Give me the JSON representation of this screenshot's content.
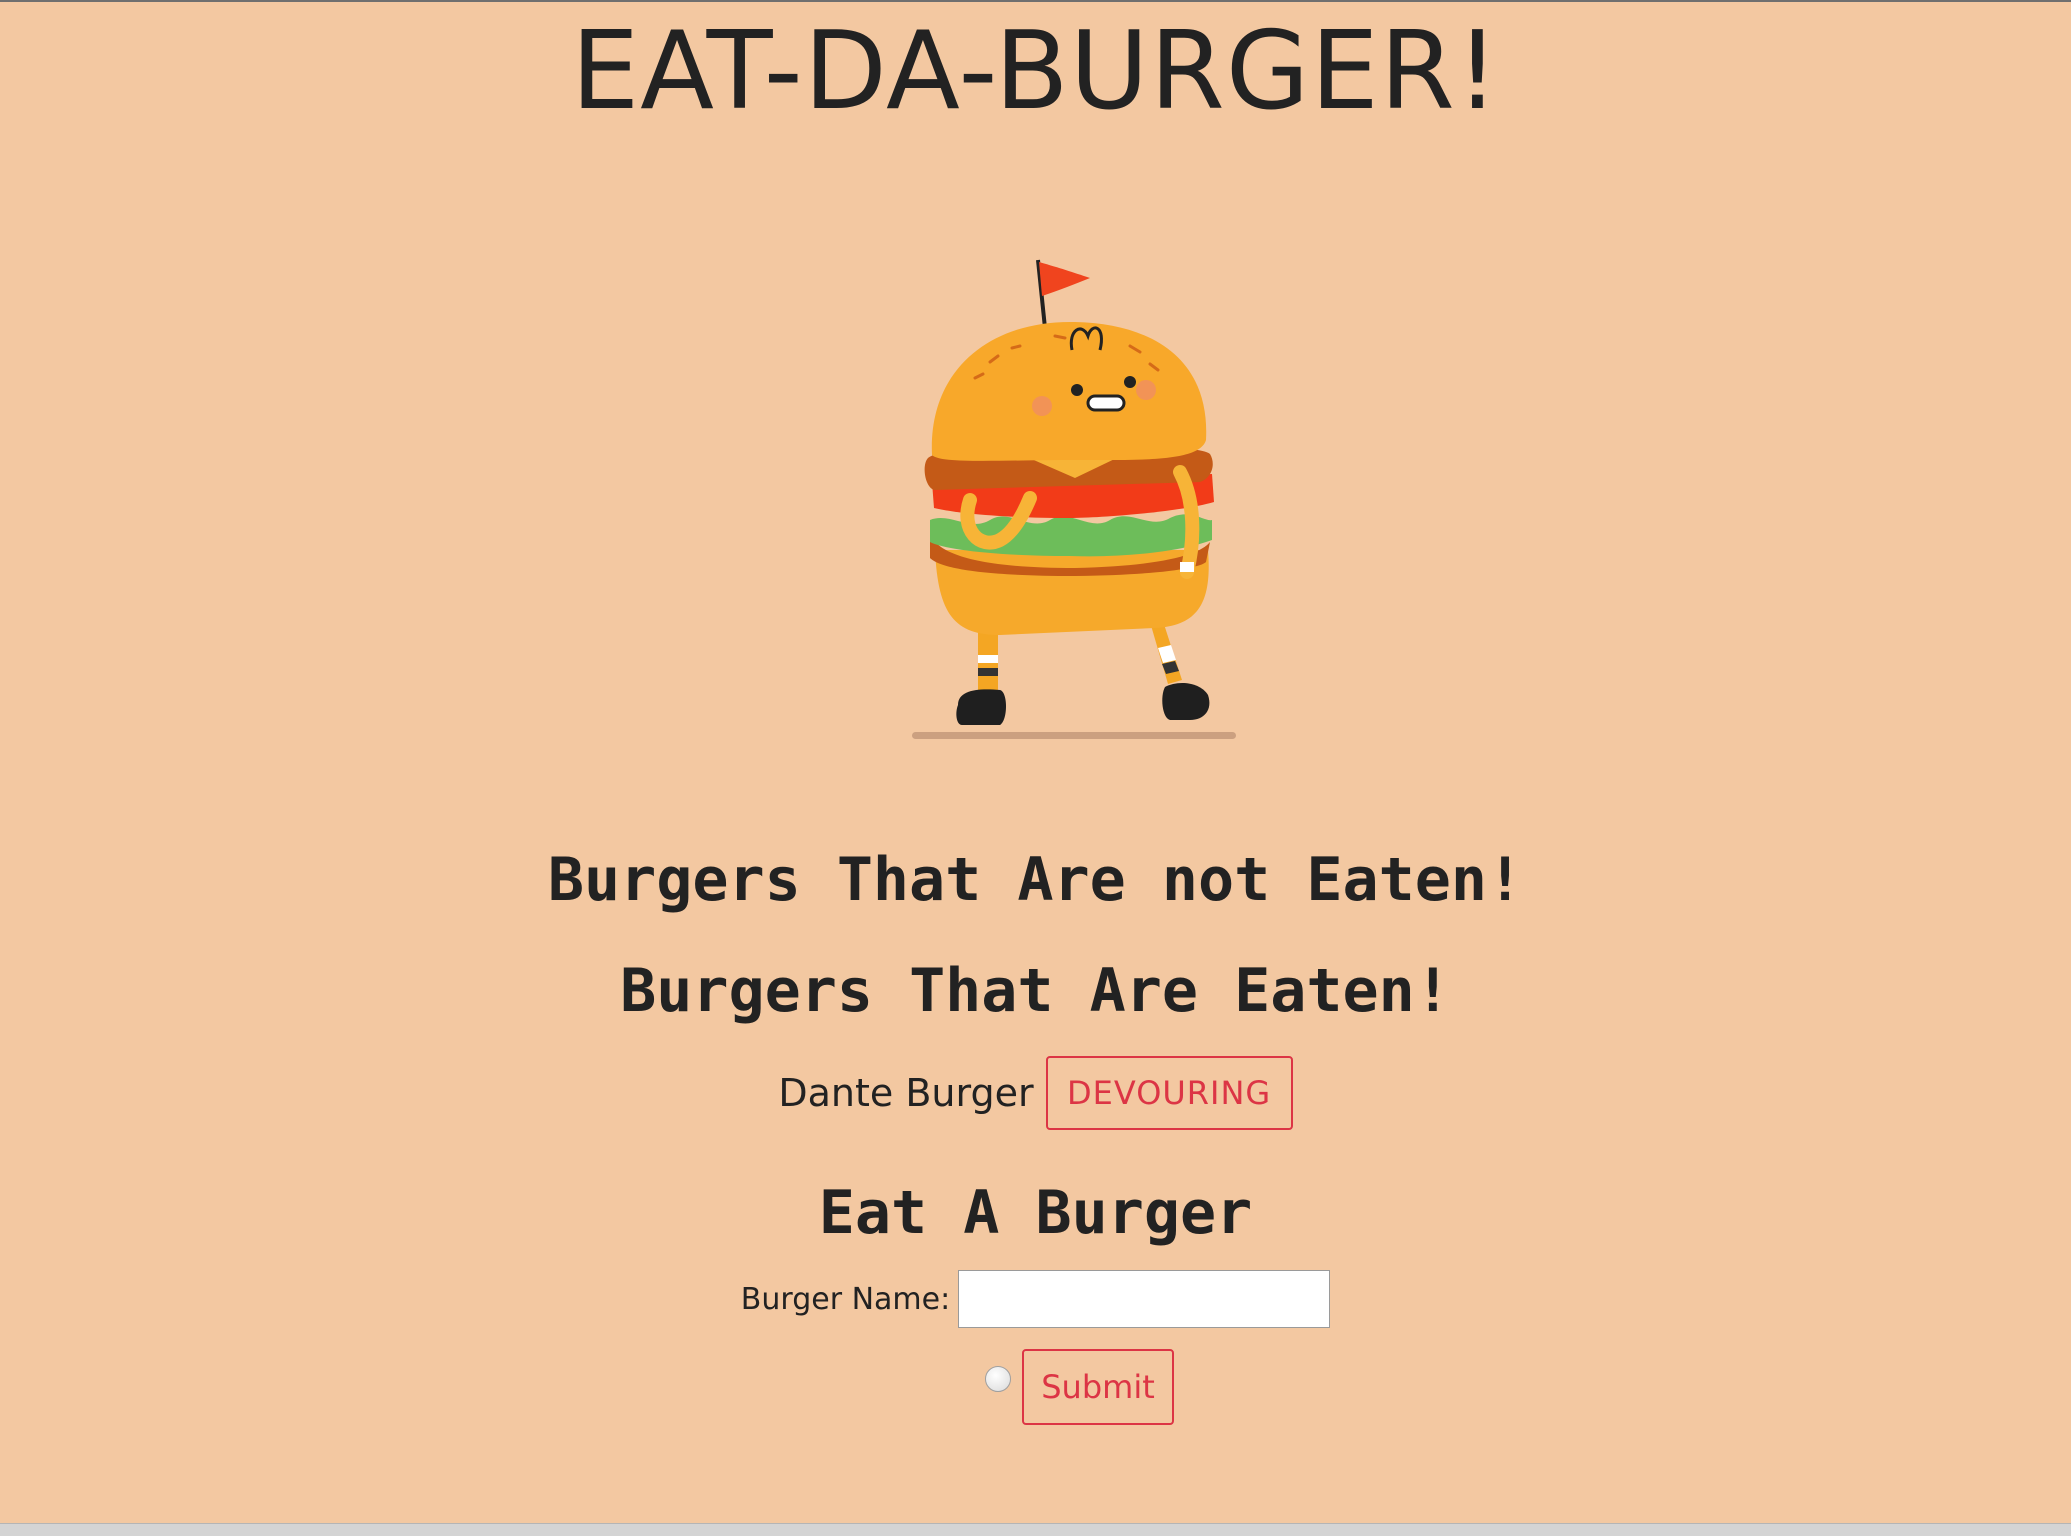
{
  "page": {
    "title": "EAT-DA-BURGER!",
    "background": "#f3c8a1",
    "accent": "#dc3545"
  },
  "sections": {
    "not_eaten_heading": "Burgers That Are not Eaten!",
    "eaten_heading": "Burgers That Are Eaten!",
    "eat_heading": "Eat A Burger"
  },
  "eaten_burgers": [
    {
      "name": "Dante Burger",
      "button_label": "DEVOURING"
    }
  ],
  "form": {
    "label": "Burger Name:",
    "input_value": "",
    "input_placeholder": "",
    "submit_label": "Submit"
  },
  "icons": {
    "hero": "burger-mascot-illustration",
    "radio": "radio-button"
  }
}
